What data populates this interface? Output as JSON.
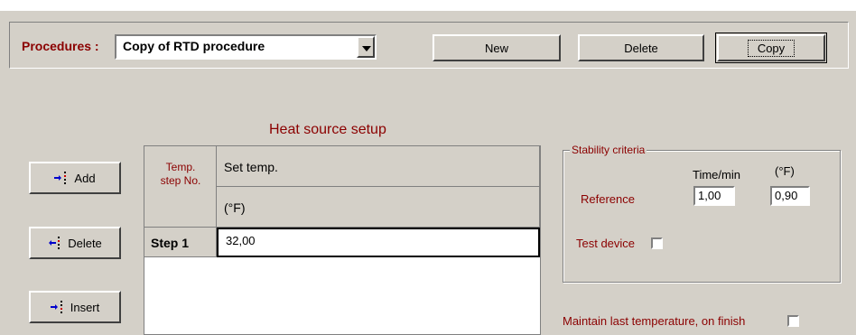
{
  "procedures": {
    "label": "Procedures :",
    "selected": "Copy of RTD procedure"
  },
  "toolbar": {
    "new_label": "New",
    "delete_label": "Delete",
    "copy_label": "Copy"
  },
  "heat_source": {
    "title": "Heat source setup",
    "col_step_line1": "Temp.",
    "col_step_line2": "step No.",
    "col_set": "Set temp.",
    "col_unit": "(°F)",
    "rows": [
      {
        "step": "Step 1",
        "value": "32,00"
      }
    ]
  },
  "side_buttons": {
    "add": "Add",
    "delete": "Delete",
    "insert": "Insert"
  },
  "stability": {
    "legend": "Stability criteria",
    "time_header": "Time/min",
    "unit_header": "(°F)",
    "reference_label": "Reference",
    "reference_time": "1,00",
    "reference_temp": "0,90",
    "test_device_label": "Test device"
  },
  "maintain": {
    "label": "Maintain last temperature, on finish"
  },
  "colors": {
    "face": "#d4d0c8",
    "label_red": "#8b0000",
    "arrow_blue": "#0000cc",
    "arrow_red": "#cc0000"
  }
}
